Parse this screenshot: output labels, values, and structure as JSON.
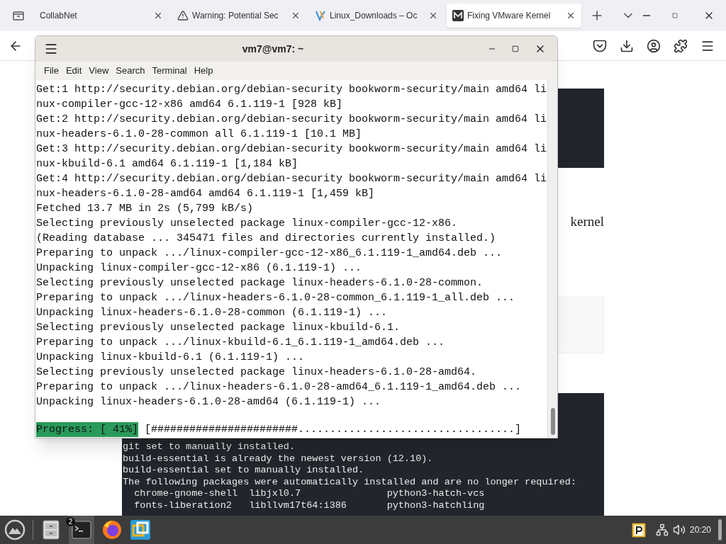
{
  "browser": {
    "tabs": [
      {
        "label": "CollabNet",
        "kind": "plain",
        "selected": false
      },
      {
        "label": "Warning: Potential Sec",
        "kind": "warning",
        "selected": false
      },
      {
        "label": "Linux_Downloads – Oc",
        "kind": "site",
        "selected": false
      },
      {
        "label": "Fixing VMware Kernel",
        "kind": "article",
        "selected": true
      }
    ],
    "page": {
      "text_fragment": "kernel",
      "code_lines": [
        "git set to manually installed.",
        "build-essential is already the newest version (12.10).",
        "build-essential set to manually installed.",
        "The following packages were automatically installed and are no longer required:",
        "  chrome-gnome-shell  libjxl0.7               python3-hatch-vcs",
        "  fonts-liberation2   libllvm17t64:i386       python3-hatchling"
      ]
    }
  },
  "terminal": {
    "title": "vm7@vm7: ~",
    "menu": [
      "File",
      "Edit",
      "View",
      "Search",
      "Terminal",
      "Help"
    ],
    "lines": [
      "Get:1 http://security.debian.org/debian-security bookworm-security/main amd64 li",
      "nux-compiler-gcc-12-x86 amd64 6.1.119-1 [928 kB]",
      "Get:2 http://security.debian.org/debian-security bookworm-security/main amd64 li",
      "nux-headers-6.1.0-28-common all 6.1.119-1 [10.1 MB]",
      "Get:3 http://security.debian.org/debian-security bookworm-security/main amd64 li",
      "nux-kbuild-6.1 amd64 6.1.119-1 [1,184 kB]",
      "Get:4 http://security.debian.org/debian-security bookworm-security/main amd64 li",
      "nux-headers-6.1.0-28-amd64 amd64 6.1.119-1 [1,459 kB]",
      "Fetched 13.7 MB in 2s (5,799 kB/s)",
      "Selecting previously unselected package linux-compiler-gcc-12-x86.",
      "(Reading database ... 345471 files and directories currently installed.)",
      "Preparing to unpack .../linux-compiler-gcc-12-x86_6.1.119-1_amd64.deb ...",
      "Unpacking linux-compiler-gcc-12-x86 (6.1.119-1) ...",
      "Selecting previously unselected package linux-headers-6.1.0-28-common.",
      "Preparing to unpack .../linux-headers-6.1.0-28-common_6.1.119-1_all.deb ...",
      "Unpacking linux-headers-6.1.0-28-common (6.1.119-1) ...",
      "Selecting previously unselected package linux-kbuild-6.1.",
      "Preparing to unpack .../linux-kbuild-6.1_6.1.119-1_amd64.deb ...",
      "Unpacking linux-kbuild-6.1 (6.1.119-1) ...",
      "Selecting previously unselected package linux-headers-6.1.0-28-amd64.",
      "Preparing to unpack .../linux-headers-6.1.0-28-amd64_6.1.119-1_amd64.deb ...",
      "Unpacking linux-headers-6.1.0-28-amd64 (6.1.119-1) ..."
    ],
    "progress_label": "Progress: [ 41%]",
    "progress_bar": "[#######################..................................]"
  },
  "taskbar": {
    "apps": [
      {
        "kind": "files"
      },
      {
        "kind": "terminal",
        "badge": "2"
      },
      {
        "kind": "firefox"
      },
      {
        "kind": "vmware"
      }
    ],
    "clock": "20:20"
  }
}
